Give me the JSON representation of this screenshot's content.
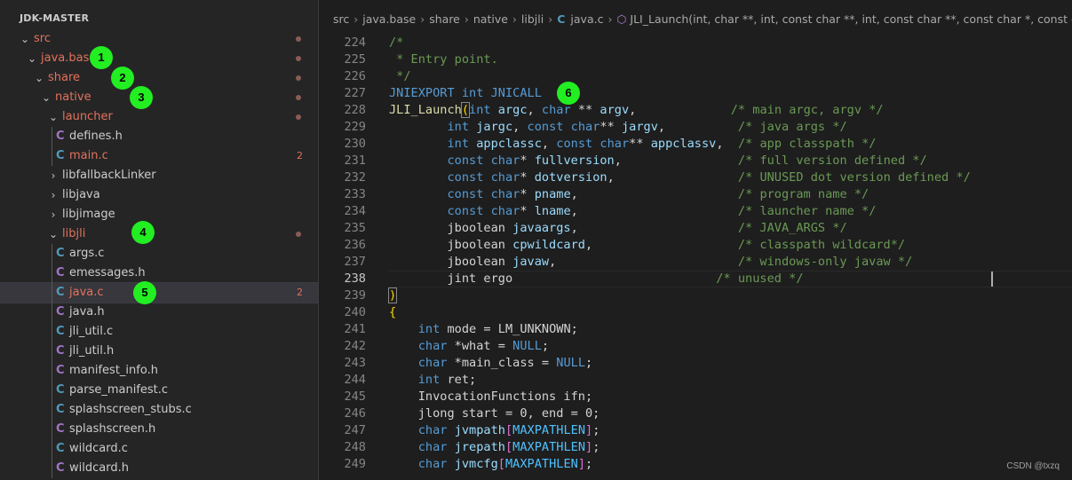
{
  "explorer": {
    "title": "JDK-MASTER",
    "items": [
      {
        "label": "src",
        "depth": 0,
        "type": "folder",
        "open": true,
        "status": "dot",
        "mod": true
      },
      {
        "label": "java.base",
        "depth": 1,
        "type": "folder",
        "open": true,
        "status": "dot",
        "mod": true
      },
      {
        "label": "share",
        "depth": 2,
        "type": "folder",
        "open": true,
        "status": "dot",
        "mod": true
      },
      {
        "label": "native",
        "depth": 3,
        "type": "folder",
        "open": true,
        "status": "dot",
        "mod": true
      },
      {
        "label": "launcher",
        "depth": 4,
        "type": "folder",
        "open": true,
        "status": "dot",
        "mod": true
      },
      {
        "label": "defines.h",
        "depth": 5,
        "type": "h",
        "mod": false
      },
      {
        "label": "main.c",
        "depth": 5,
        "type": "c",
        "mod": true,
        "count": "2"
      },
      {
        "label": "libfallbackLinker",
        "depth": 4,
        "type": "folder",
        "open": false,
        "mod": false
      },
      {
        "label": "libjava",
        "depth": 4,
        "type": "folder",
        "open": false,
        "mod": false
      },
      {
        "label": "libjimage",
        "depth": 4,
        "type": "folder",
        "open": false,
        "mod": false
      },
      {
        "label": "libjli",
        "depth": 4,
        "type": "folder",
        "open": true,
        "status": "dot",
        "mod": true
      },
      {
        "label": "args.c",
        "depth": 5,
        "type": "c",
        "mod": false
      },
      {
        "label": "emessages.h",
        "depth": 5,
        "type": "h",
        "mod": false
      },
      {
        "label": "java.c",
        "depth": 5,
        "type": "c",
        "mod": true,
        "count": "2",
        "selected": true
      },
      {
        "label": "java.h",
        "depth": 5,
        "type": "h",
        "mod": false
      },
      {
        "label": "jli_util.c",
        "depth": 5,
        "type": "c",
        "mod": false
      },
      {
        "label": "jli_util.h",
        "depth": 5,
        "type": "h",
        "mod": false
      },
      {
        "label": "manifest_info.h",
        "depth": 5,
        "type": "h",
        "mod": false
      },
      {
        "label": "parse_manifest.c",
        "depth": 5,
        "type": "c",
        "mod": false
      },
      {
        "label": "splashscreen_stubs.c",
        "depth": 5,
        "type": "c",
        "mod": false
      },
      {
        "label": "splashscreen.h",
        "depth": 5,
        "type": "h",
        "mod": false
      },
      {
        "label": "wildcard.c",
        "depth": 5,
        "type": "c",
        "mod": false
      },
      {
        "label": "wildcard.h",
        "depth": 5,
        "type": "h",
        "mod": false
      }
    ]
  },
  "markers": [
    "1",
    "2",
    "3",
    "4",
    "5",
    "6"
  ],
  "breadcrumb": {
    "parts": [
      "src",
      "java.base",
      "share",
      "native",
      "libjli"
    ],
    "file": "java.c",
    "symbol": "JLI_Launch(int, char **, int, const char **, int, const char **, const char *, const char *,"
  },
  "code": {
    "current_line": "238",
    "lines": [
      {
        "n": "224",
        "t": [
          [
            "cmt",
            "/*"
          ]
        ]
      },
      {
        "n": "225",
        "t": [
          [
            "cmt",
            " * Entry point."
          ]
        ]
      },
      {
        "n": "226",
        "t": [
          [
            "cmt",
            " */"
          ]
        ]
      },
      {
        "n": "227",
        "t": [
          [
            "kw",
            "JNIEXPORT"
          ],
          [
            "plain",
            " "
          ],
          [
            "kw",
            "int"
          ],
          [
            "plain",
            " "
          ],
          [
            "kw",
            "JNICALL"
          ]
        ]
      },
      {
        "n": "228",
        "t": [
          [
            "fn",
            "JLI_Launch"
          ],
          [
            "br1",
            "("
          ],
          [
            "kw",
            "int"
          ],
          [
            "plain",
            " "
          ],
          [
            "var",
            "argc"
          ],
          [
            "plain",
            ", "
          ],
          [
            "kw",
            "char"
          ],
          [
            "plain",
            " ** "
          ],
          [
            "var",
            "argv"
          ],
          [
            "plain",
            ",             "
          ],
          [
            "cmt",
            "/* main argc, argv */"
          ]
        ]
      },
      {
        "n": "229",
        "t": [
          [
            "plain",
            "        "
          ],
          [
            "kw",
            "int"
          ],
          [
            "plain",
            " "
          ],
          [
            "var",
            "jargc"
          ],
          [
            "plain",
            ", "
          ],
          [
            "kw",
            "const"
          ],
          [
            "plain",
            " "
          ],
          [
            "kw",
            "char"
          ],
          [
            "plain",
            "** "
          ],
          [
            "var",
            "jargv"
          ],
          [
            "plain",
            ",          "
          ],
          [
            "cmt",
            "/* java args */"
          ]
        ]
      },
      {
        "n": "230",
        "t": [
          [
            "plain",
            "        "
          ],
          [
            "kw",
            "int"
          ],
          [
            "plain",
            " "
          ],
          [
            "var",
            "appclassc"
          ],
          [
            "plain",
            ", "
          ],
          [
            "kw",
            "const"
          ],
          [
            "plain",
            " "
          ],
          [
            "kw",
            "char"
          ],
          [
            "plain",
            "** "
          ],
          [
            "var",
            "appclassv"
          ],
          [
            "plain",
            ",  "
          ],
          [
            "cmt",
            "/* app classpath */"
          ]
        ]
      },
      {
        "n": "231",
        "t": [
          [
            "plain",
            "        "
          ],
          [
            "kw",
            "const"
          ],
          [
            "plain",
            " "
          ],
          [
            "kw",
            "char"
          ],
          [
            "plain",
            "* "
          ],
          [
            "var",
            "fullversion"
          ],
          [
            "plain",
            ",                "
          ],
          [
            "cmt",
            "/* full version defined */"
          ]
        ]
      },
      {
        "n": "232",
        "t": [
          [
            "plain",
            "        "
          ],
          [
            "kw",
            "const"
          ],
          [
            "plain",
            " "
          ],
          [
            "kw",
            "char"
          ],
          [
            "plain",
            "* "
          ],
          [
            "var",
            "dotversion"
          ],
          [
            "plain",
            ",                 "
          ],
          [
            "cmt",
            "/* UNUSED dot version defined */"
          ]
        ]
      },
      {
        "n": "233",
        "t": [
          [
            "plain",
            "        "
          ],
          [
            "kw",
            "const"
          ],
          [
            "plain",
            " "
          ],
          [
            "kw",
            "char"
          ],
          [
            "plain",
            "* "
          ],
          [
            "var",
            "pname"
          ],
          [
            "plain",
            ",                      "
          ],
          [
            "cmt",
            "/* program name */"
          ]
        ]
      },
      {
        "n": "234",
        "t": [
          [
            "plain",
            "        "
          ],
          [
            "kw",
            "const"
          ],
          [
            "plain",
            " "
          ],
          [
            "kw",
            "char"
          ],
          [
            "plain",
            "* "
          ],
          [
            "var",
            "lname"
          ],
          [
            "plain",
            ",                      "
          ],
          [
            "cmt",
            "/* launcher name */"
          ]
        ]
      },
      {
        "n": "235",
        "t": [
          [
            "plain",
            "        jboolean "
          ],
          [
            "var",
            "javaargs"
          ],
          [
            "plain",
            ",                      "
          ],
          [
            "cmt",
            "/* JAVA_ARGS */"
          ]
        ]
      },
      {
        "n": "236",
        "t": [
          [
            "plain",
            "        jboolean "
          ],
          [
            "var",
            "cpwildcard"
          ],
          [
            "plain",
            ",                    "
          ],
          [
            "cmt",
            "/* classpath wildcard*/"
          ]
        ]
      },
      {
        "n": "237",
        "t": [
          [
            "plain",
            "        jboolean "
          ],
          [
            "var",
            "javaw"
          ],
          [
            "plain",
            ",                         "
          ],
          [
            "cmt",
            "/* windows-only javaw */"
          ]
        ]
      },
      {
        "n": "238",
        "t": [
          [
            "plain",
            "        jint ergo                            "
          ],
          [
            "cmt",
            "/* unused */"
          ]
        ]
      },
      {
        "n": "239",
        "t": [
          [
            "br1",
            ")"
          ]
        ]
      },
      {
        "n": "240",
        "t": [
          [
            "br1",
            "{"
          ]
        ]
      },
      {
        "n": "241",
        "t": [
          [
            "plain",
            "    "
          ],
          [
            "kw",
            "int"
          ],
          [
            "plain",
            " mode = LM_UNKNOWN;"
          ]
        ]
      },
      {
        "n": "242",
        "t": [
          [
            "plain",
            "    "
          ],
          [
            "kw",
            "char"
          ],
          [
            "plain",
            " *what = "
          ],
          [
            "kw",
            "NULL"
          ],
          [
            "plain",
            ";"
          ]
        ]
      },
      {
        "n": "243",
        "t": [
          [
            "plain",
            "    "
          ],
          [
            "kw",
            "char"
          ],
          [
            "plain",
            " *main_class = "
          ],
          [
            "kw",
            "NULL"
          ],
          [
            "plain",
            ";"
          ]
        ]
      },
      {
        "n": "244",
        "t": [
          [
            "plain",
            "    "
          ],
          [
            "kw",
            "int"
          ],
          [
            "plain",
            " ret;"
          ]
        ]
      },
      {
        "n": "245",
        "t": [
          [
            "plain",
            "    InvocationFunctions ifn;"
          ]
        ]
      },
      {
        "n": "246",
        "t": [
          [
            "plain",
            "    jlong start = 0, end = 0;"
          ]
        ]
      },
      {
        "n": "247",
        "t": [
          [
            "plain",
            "    "
          ],
          [
            "kw",
            "char"
          ],
          [
            "plain",
            " "
          ],
          [
            "var",
            "jvmpath"
          ],
          [
            "br2",
            "["
          ],
          [
            "mac",
            "MAXPATHLEN"
          ],
          [
            "br2",
            "]"
          ],
          [
            "plain",
            ";"
          ]
        ]
      },
      {
        "n": "248",
        "t": [
          [
            "plain",
            "    "
          ],
          [
            "kw",
            "char"
          ],
          [
            "plain",
            " "
          ],
          [
            "var",
            "jrepath"
          ],
          [
            "br2",
            "["
          ],
          [
            "mac",
            "MAXPATHLEN"
          ],
          [
            "br2",
            "]"
          ],
          [
            "plain",
            ";"
          ]
        ]
      },
      {
        "n": "249",
        "t": [
          [
            "plain",
            "    "
          ],
          [
            "kw",
            "char"
          ],
          [
            "plain",
            " "
          ],
          [
            "var",
            "jvmcfg"
          ],
          [
            "br2",
            "["
          ],
          [
            "mac",
            "MAXPATHLEN"
          ],
          [
            "br2",
            "]"
          ],
          [
            "plain",
            ";"
          ]
        ]
      }
    ]
  },
  "watermark": "CSDN @txzq",
  "colors": {
    "accent": "#22ee22",
    "modified": "#e2725b",
    "c_icon": "#519aba",
    "h_icon": "#a074c4"
  }
}
